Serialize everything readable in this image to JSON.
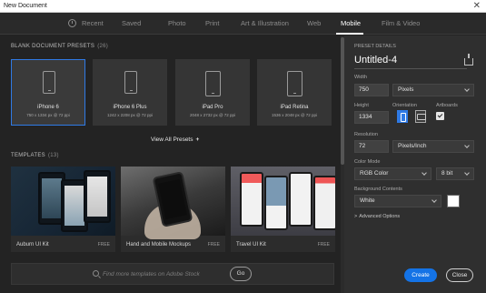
{
  "window": {
    "title": "New Document",
    "close_glyph": "✕"
  },
  "tabs": [
    {
      "label": "Recent"
    },
    {
      "label": "Saved"
    },
    {
      "label": "Photo"
    },
    {
      "label": "Print"
    },
    {
      "label": "Art & Illustration"
    },
    {
      "label": "Web"
    },
    {
      "label": "Mobile",
      "active": true
    },
    {
      "label": "Film & Video"
    }
  ],
  "blank_presets": {
    "title": "BLANK DOCUMENT PRESETS",
    "count": "(26)",
    "items": [
      {
        "name": "iPhone 6",
        "size": "750 x 1334 px @ 72 ppi",
        "selected": true
      },
      {
        "name": "iPhone 6 Plus",
        "size": "1242 x 2208 px @ 72 ppi"
      },
      {
        "name": "iPad Pro",
        "size": "2048 x 2732 px @ 72 ppi"
      },
      {
        "name": "iPad Retina",
        "size": "1536 x 2048 px @ 72 ppi"
      }
    ],
    "view_all_label": "View All Presets",
    "view_all_plus": "+"
  },
  "templates": {
    "title": "TEMPLATES",
    "count": "(13)",
    "items": [
      {
        "name": "Auburn UI Kit",
        "badge": "FREE"
      },
      {
        "name": "Hand and Mobile Mockups",
        "badge": "FREE"
      },
      {
        "name": "Travel UI Kit",
        "badge": "FREE"
      }
    ]
  },
  "search": {
    "placeholder": "Find more templates on Adobe Stock",
    "go_label": "Go"
  },
  "preset_details": {
    "title": "PRESET DETAILS",
    "doc_name": "Untitled-4",
    "width_label": "Width",
    "width_value": "750",
    "width_unit": "Pixels",
    "height_label": "Height",
    "height_value": "1334",
    "orientation_label": "Orientation",
    "artboards_label": "Artboards",
    "artboards_checked": true,
    "resolution_label": "Resolution",
    "resolution_value": "72",
    "resolution_unit": "Pixels/Inch",
    "color_mode_label": "Color Mode",
    "color_mode_value": "RGB Color",
    "bit_depth": "8 bit",
    "background_label": "Background Contents",
    "background_value": "White",
    "background_swatch": "#ffffff",
    "advanced_label": "Advanced Options",
    "advanced_caret": ">"
  },
  "actions": {
    "create": "Create",
    "close": "Close"
  },
  "colors": {
    "accent": "#2f7ae5",
    "primary_button": "#1473e6",
    "panel": "#2f2f2f",
    "background": "#232323"
  }
}
